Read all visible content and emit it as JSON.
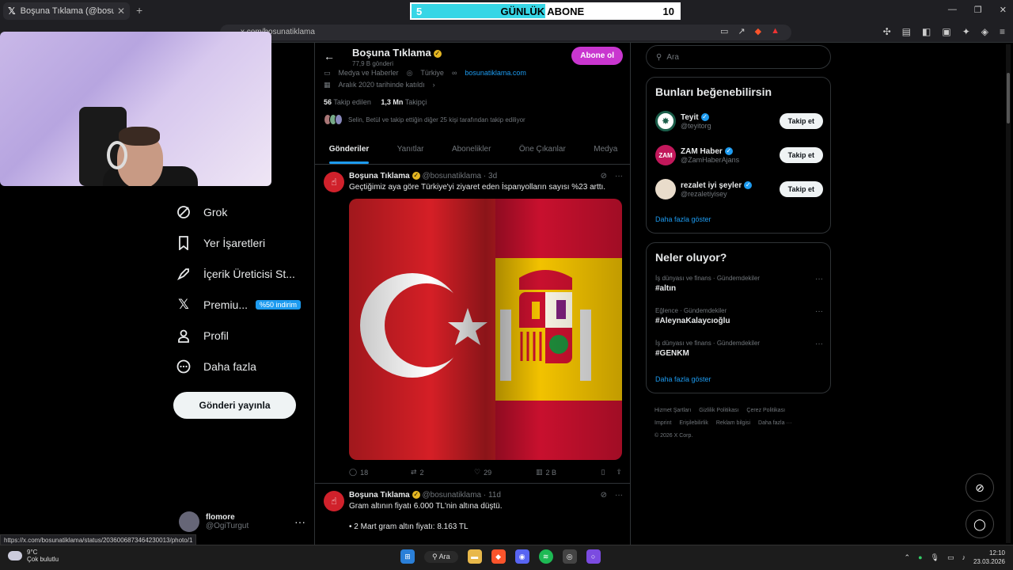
{
  "browser": {
    "tab_title": "Boşuna Tıklama (@bosunatiklama",
    "url": "x.com/bosunatiklama",
    "status_url": "https://x.com/bosunatiklama/status/2036006873464230013/photo/1"
  },
  "overlay": {
    "sub_left": "5",
    "sub_label": "GÜNLÜK ABONE",
    "sub_right": "10",
    "progress": 0.5
  },
  "left_nav": {
    "items": [
      {
        "label": "Grok",
        "icon": "grok-icon"
      },
      {
        "label": "Yer İşaretleri",
        "icon": "bookmark-icon"
      },
      {
        "label": "İçerik Üreticisi St...",
        "icon": "rocket-icon"
      },
      {
        "label": "Premiu...",
        "icon": "x-logo-icon",
        "badge": "%50 indirim"
      },
      {
        "label": "Profil",
        "icon": "person-icon"
      },
      {
        "label": "Daha fazla",
        "icon": "more-circle-icon"
      }
    ],
    "post_button": "Gönderi yayınla",
    "account": {
      "name": "flomore",
      "handle": "@OgiTurgut"
    }
  },
  "profile": {
    "name": "Boşuna Tıklama",
    "post_count": "77,9 B gönderi",
    "subscribe": "Abone ol",
    "category": "Medya ve Haberler",
    "location": "Türkiye",
    "website": "bosunatiklama.com",
    "joined": "Aralık 2020 tarihinde katıldı",
    "following_count": "56",
    "following_label": "Takip edilen",
    "followers_count": "1,3 Mn",
    "followers_label": "Takipçi",
    "followed_by": "Selin, Betül ve takip ettiğin diğer 25 kişi tarafından takip ediliyor",
    "tabs": [
      "Gönderiler",
      "Yanıtlar",
      "Abonelikler",
      "Öne Çıkanlar",
      "Medya"
    ]
  },
  "tweets": [
    {
      "name": "Boşuna Tıklama",
      "handle": "@bosunatiklama",
      "time": "· 3d",
      "text": "Geçtiğimiz aya göre Türkiye'yi ziyaret eden İspanyolların sayısı %23 arttı.",
      "replies": "18",
      "retweets": "2",
      "likes": "29",
      "views": "2 B"
    },
    {
      "name": "Boşuna Tıklama",
      "handle": "@bosunatiklama",
      "time": "· 11d",
      "text": "Gram altının fiyatı 6.000 TL'nin altına düştü.",
      "text2": "• 2 Mart gram altın fiyatı: 8.163 TL"
    }
  ],
  "right": {
    "search_placeholder": "Ara",
    "suggest_title": "Bunları beğenebilirsin",
    "suggestions": [
      {
        "name": "Teyit",
        "handle": "@teyitorg",
        "button": "Takip et"
      },
      {
        "name": "ZAM Haber",
        "handle": "@ZamHaberAjans",
        "button": "Takip et",
        "avatar_text": "ZAM"
      },
      {
        "name": "rezalet iyi şeyler",
        "handle": "@rezaletiyisey",
        "button": "Takip et"
      }
    ],
    "suggest_more": "Daha fazla göster",
    "trends_title": "Neler oluyor?",
    "trends": [
      {
        "context": "İş dünyası ve finans · Gündemdekiler",
        "tag": "#altın"
      },
      {
        "context": "Eğlence · Gündemdekiler",
        "tag": "#AleynaKalaycıoğlu"
      },
      {
        "context": "İş dünyası ve finans · Gündemdekiler",
        "tag": "#GENKM"
      }
    ],
    "trends_more": "Daha fazla göster",
    "footer": [
      "Hizmet Şartları",
      "Gizlilik Politikası",
      "Çerez Politikası",
      "Imprint",
      "Erişilebilirlik",
      "Reklam bilgisi",
      "Daha fazla ···",
      "© 2026 X Corp."
    ]
  },
  "taskbar": {
    "temp": "9°C",
    "weather": "Çok bulutlu",
    "search": "Ara",
    "time": "12:10",
    "date": "23.03.2026"
  },
  "colors": {
    "accent": "#1d9bf0",
    "subscribe": "#c936cf",
    "progress": "#36d6e6"
  }
}
